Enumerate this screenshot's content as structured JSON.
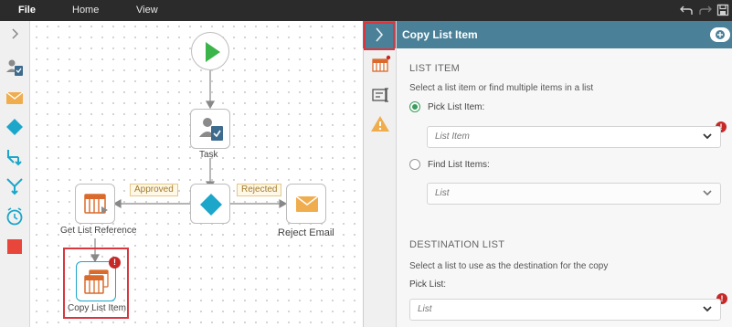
{
  "menubar": {
    "items": [
      {
        "label": "File"
      },
      {
        "label": "Home"
      },
      {
        "label": "View"
      }
    ]
  },
  "canvas": {
    "nodes": {
      "task_label": "Task",
      "get_list_label": "Get List Reference",
      "reject_label": "Reject Email",
      "copy_label": "Copy List Item"
    },
    "tags": {
      "approved": "Approved",
      "rejected": "Rejected"
    }
  },
  "panel": {
    "title": "Copy List Item",
    "list_item": {
      "section_title": "LIST ITEM",
      "description": "Select a list item or find multiple items in a list",
      "pick_label": "Pick List Item:",
      "pick_placeholder": "List Item",
      "find_label": "Find List Items:",
      "find_placeholder": "List"
    },
    "destination": {
      "section_title": "DESTINATION LIST",
      "description": "Select a list to use as the destination for the copy",
      "pick_list_label": "Pick List:",
      "pick_list_placeholder": "List"
    }
  },
  "colors": {
    "accent": "#4b8198",
    "error": "#c62828",
    "success": "#3a9d5d",
    "highlight": "#d9363e"
  }
}
